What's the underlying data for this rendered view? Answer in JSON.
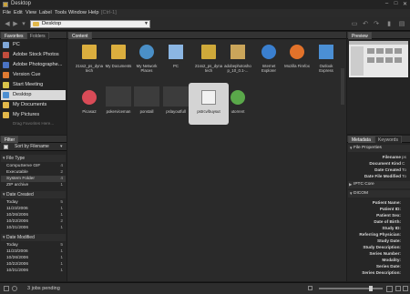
{
  "window": {
    "title": "Desktop",
    "controls": [
      "–",
      "□",
      "✕"
    ]
  },
  "menu": {
    "items": [
      "File",
      "Edit",
      "View",
      "Label",
      "Tools",
      "Window",
      "Help"
    ],
    "dim_item": "[Ctrl-1]"
  },
  "toolbar": {
    "path": "Desktop"
  },
  "panels": {
    "favorites_tab": "Favorites",
    "folders_tab": "Folders",
    "content_tab": "Content",
    "preview_tab": "Preview",
    "filter_tab": "Filter",
    "metadata_tab": "Metadata",
    "keywords_tab": "Keywords"
  },
  "favorites": [
    {
      "label": "PC",
      "color": "#7fa7d8"
    },
    {
      "label": "Adobe Stock Photos",
      "color": "#c24d3d"
    },
    {
      "label": "Adobe Photographe...",
      "color": "#4a73c4"
    },
    {
      "label": "Version Cue",
      "color": "#e07b32"
    },
    {
      "label": "Start Meeting",
      "color": "#d9c44a"
    },
    {
      "label": "Desktop",
      "color": "#4d8fd1",
      "selected": true
    },
    {
      "label": "My Documents",
      "color": "#e2b84a"
    },
    {
      "label": "My Pictures",
      "color": "#e2b84a"
    },
    {
      "label": "Drag Favorites Here...",
      "color": "",
      "dim": true
    }
  ],
  "filter": {
    "sort_label": "Sort by Filename",
    "groups": [
      {
        "title": "File Type",
        "rows": [
          {
            "label": "CompuServe GIF",
            "count": "4"
          },
          {
            "label": "Executable",
            "count": "2"
          },
          {
            "label": "System Folder",
            "count": "4"
          },
          {
            "label": "ZIP archive",
            "count": "1"
          }
        ]
      },
      {
        "title": "Date Created",
        "rows": [
          {
            "label": "Today",
            "count": "5"
          },
          {
            "label": "11/23/2006",
            "count": "1"
          },
          {
            "label": "10/26/2006",
            "count": "1"
          },
          {
            "label": "10/22/2006",
            "count": "2"
          },
          {
            "label": "10/21/2006",
            "count": "1"
          }
        ]
      },
      {
        "title": "Date Modified",
        "rows": [
          {
            "label": "Today",
            "count": "5"
          },
          {
            "label": "11/23/2006",
            "count": "1"
          },
          {
            "label": "10/26/2006",
            "count": "1"
          },
          {
            "label": "10/22/2006",
            "count": "1"
          },
          {
            "label": "10/21/2006",
            "count": "1"
          }
        ]
      }
    ]
  },
  "content_items": [
    {
      "label": "21ss2_ps_dyna\ntech",
      "icon": "folder"
    },
    {
      "label": "My Documents",
      "icon": "folder"
    },
    {
      "label": "My Network\nPlaces",
      "icon": "network"
    },
    {
      "label": "PC",
      "icon": "pc"
    },
    {
      "label": "21ss2_ps_dyna\ntech",
      "icon": "zip"
    },
    {
      "label": "adobephotosho\np_10_0.1-...",
      "icon": "exe"
    },
    {
      "label": "Internet\nExplorer",
      "icon": "ie"
    },
    {
      "label": "Mozilla Firefox",
      "icon": "firefox"
    },
    {
      "label": "Outlook\nExpress",
      "icon": "outlook"
    },
    {
      "label": "Picasa2",
      "icon": "picasa"
    },
    {
      "label": "pokerviceman",
      "icon": "blank"
    },
    {
      "label": "ponstall",
      "icon": "blank"
    },
    {
      "label": "pslayoutfull",
      "icon": "blank"
    },
    {
      "label": "pstrcv/buysut",
      "icon": "doc",
      "selected": true
    },
    {
      "label": "utorrent",
      "icon": "utorrent"
    }
  ],
  "metadata": {
    "file_props_title": "File Properties",
    "file_props": [
      {
        "key": "Filename",
        "value": "ps"
      },
      {
        "key": "Document Kind",
        "value": "C"
      },
      {
        "key": "Date Created",
        "value": "To"
      },
      {
        "key": "Date File Modified",
        "value": "To"
      }
    ],
    "iptc_title": "IPTC Core",
    "dicom_title": "DICOM",
    "dicom_fields": [
      "Patient Name:",
      "Patient ID:",
      "Patient Sex:",
      "Date of Birth:",
      "Study ID:",
      "Referring Physician:",
      "Study Date:",
      "Study Description:",
      "Series Number:",
      "Modality:",
      "Series Date:",
      "Series Description:"
    ]
  },
  "status": {
    "text": "3 jobs pending"
  }
}
